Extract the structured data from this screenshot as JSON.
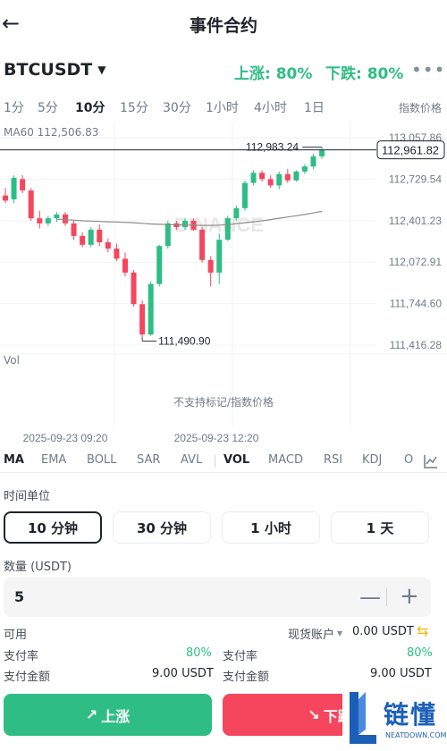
{
  "header": {
    "title": "事件合约",
    "back_icon": "arrow-left"
  },
  "pair": {
    "symbol": "BTCUSDT"
  },
  "stats": {
    "up_label": "上涨: 80%",
    "down_label": "下跌: 80%",
    "up_color": "#2ebd85"
  },
  "intervals": {
    "items": [
      "1分",
      "5分",
      "10分",
      "15分",
      "30分",
      "1小时",
      "4小时",
      "1日"
    ],
    "active": "10分",
    "index_price_label": "指数价格"
  },
  "chart_meta": {
    "ma60_label": "MA60 112,506.83",
    "vol_label": "Vol",
    "no_mark_text": "不支持标记/指数价格",
    "watermark": "BINANCE"
  },
  "chart_data": {
    "type": "candlestick",
    "y_ticks": [
      "113,057.86",
      "112,729.54",
      "112,401.23",
      "112,072.91",
      "111,744.60",
      "111,416.28"
    ],
    "y_range": [
      111416.28,
      113057.86
    ],
    "x_tick_labels": [
      "2025-09-23 09:20",
      "2025-09-23 12:20"
    ],
    "current_price": "112,961.82",
    "high_label": "112,983.24",
    "low_label": "111,490.90",
    "colors": {
      "up": "#2ebd85",
      "down": "#f6465d",
      "ma": "#8c8c8c"
    },
    "candles": [
      {
        "o": 112600,
        "h": 112660,
        "l": 112540,
        "c": 112560
      },
      {
        "o": 112570,
        "h": 112760,
        "l": 112540,
        "c": 112740
      },
      {
        "o": 112730,
        "h": 112760,
        "l": 112620,
        "c": 112640
      },
      {
        "o": 112640,
        "h": 112660,
        "l": 112400,
        "c": 112420
      },
      {
        "o": 112420,
        "h": 112480,
        "l": 112340,
        "c": 112380
      },
      {
        "o": 112380,
        "h": 112440,
        "l": 112360,
        "c": 112420
      },
      {
        "o": 112420,
        "h": 112470,
        "l": 112390,
        "c": 112450
      },
      {
        "o": 112450,
        "h": 112470,
        "l": 112360,
        "c": 112380
      },
      {
        "o": 112380,
        "h": 112400,
        "l": 112250,
        "c": 112280
      },
      {
        "o": 112280,
        "h": 112310,
        "l": 112190,
        "c": 112210
      },
      {
        "o": 112210,
        "h": 112350,
        "l": 112190,
        "c": 112330
      },
      {
        "o": 112330,
        "h": 112370,
        "l": 112200,
        "c": 112230
      },
      {
        "o": 112230,
        "h": 112260,
        "l": 112150,
        "c": 112180
      },
      {
        "o": 112180,
        "h": 112220,
        "l": 112080,
        "c": 112100
      },
      {
        "o": 112100,
        "h": 112150,
        "l": 111960,
        "c": 111990
      },
      {
        "o": 111990,
        "h": 112010,
        "l": 111720,
        "c": 111740
      },
      {
        "o": 111740,
        "h": 111770,
        "l": 111480,
        "c": 111500
      },
      {
        "o": 111500,
        "h": 111920,
        "l": 111490,
        "c": 111900
      },
      {
        "o": 111900,
        "h": 112210,
        "l": 111880,
        "c": 112200
      },
      {
        "o": 112200,
        "h": 112400,
        "l": 112180,
        "c": 112380
      },
      {
        "o": 112380,
        "h": 112400,
        "l": 112330,
        "c": 112350
      },
      {
        "o": 112350,
        "h": 112420,
        "l": 112330,
        "c": 112400
      },
      {
        "o": 112400,
        "h": 112420,
        "l": 112320,
        "c": 112330
      },
      {
        "o": 112330,
        "h": 112350,
        "l": 112070,
        "c": 112090
      },
      {
        "o": 112090,
        "h": 112120,
        "l": 111880,
        "c": 111990
      },
      {
        "o": 111990,
        "h": 112300,
        "l": 111900,
        "c": 112250
      },
      {
        "o": 112250,
        "h": 112440,
        "l": 112240,
        "c": 112420
      },
      {
        "o": 112420,
        "h": 112520,
        "l": 112400,
        "c": 112500
      },
      {
        "o": 112500,
        "h": 112720,
        "l": 112480,
        "c": 112700
      },
      {
        "o": 112700,
        "h": 112800,
        "l": 112680,
        "c": 112780
      },
      {
        "o": 112780,
        "h": 112800,
        "l": 112710,
        "c": 112730
      },
      {
        "o": 112730,
        "h": 112760,
        "l": 112660,
        "c": 112680
      },
      {
        "o": 112680,
        "h": 112790,
        "l": 112650,
        "c": 112770
      },
      {
        "o": 112770,
        "h": 112810,
        "l": 112700,
        "c": 112720
      },
      {
        "o": 112720,
        "h": 112800,
        "l": 112710,
        "c": 112790
      },
      {
        "o": 112790,
        "h": 112850,
        "l": 112770,
        "c": 112830
      },
      {
        "o": 112830,
        "h": 112930,
        "l": 112810,
        "c": 112910
      },
      {
        "o": 112910,
        "h": 112983,
        "l": 112890,
        "c": 112962
      }
    ],
    "ma60": [
      112480,
      112460,
      112440,
      112430,
      112420,
      112415,
      112412,
      112410,
      112405,
      112400,
      112398,
      112395,
      112392,
      112390,
      112388,
      112385,
      112380,
      112375,
      112372,
      112370,
      112368,
      112366,
      112365,
      112364,
      112364,
      112366,
      112370,
      112378,
      112385,
      112392,
      112400,
      112410,
      112420,
      112430,
      112440,
      112450,
      112462,
      112475
    ]
  },
  "indicators": {
    "items": [
      "MA",
      "EMA",
      "BOLL",
      "SAR",
      "AVL",
      "VOL",
      "MACD",
      "RSI",
      "KDJ",
      "O"
    ],
    "active": [
      "MA",
      "VOL"
    ]
  },
  "time_unit": {
    "label": "时间单位",
    "options": [
      "10 分钟",
      "30 分钟",
      "1 小时",
      "1 天"
    ],
    "active": "10 分钟"
  },
  "quantity": {
    "label": "数量 (USDT)",
    "value": "5"
  },
  "available": {
    "label": "可用",
    "account": "现货账户",
    "amount": "0.00 USDT"
  },
  "left_info": {
    "rate_label": "支付率",
    "rate_value": "80%",
    "amount_label": "支付金额",
    "amount_value": "9.00 USDT"
  },
  "right_info": {
    "rate_label": "支付率",
    "rate_value": "80%",
    "amount_label": "支付金额",
    "amount_value": "9.00 USDT"
  },
  "actions": {
    "up_label": "上涨",
    "down_label": "下跌"
  },
  "logo": {
    "text": "链懂",
    "subtext": "NEATDOWN.COM"
  }
}
